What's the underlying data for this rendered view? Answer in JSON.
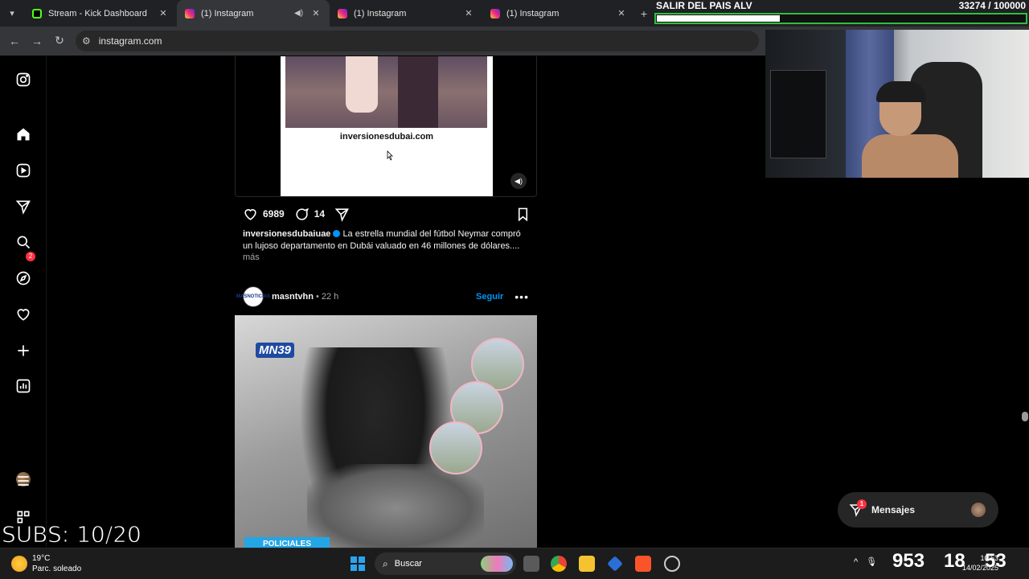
{
  "browser": {
    "tabs": [
      {
        "title": "Stream - Kick Dashboard",
        "favicon": "kick-icon",
        "active": false
      },
      {
        "title": "(1) Instagram",
        "favicon": "instagram-icon",
        "active": true,
        "audio": true
      },
      {
        "title": "(1) Instagram",
        "favicon": "instagram-icon",
        "active": false
      },
      {
        "title": "(1) Instagram",
        "favicon": "instagram-icon",
        "active": false
      }
    ],
    "url": "instagram.com"
  },
  "sidebar": {
    "notifications_badge": "2",
    "icons": [
      "instagram-logo-icon",
      "home-icon",
      "reels-icon",
      "messages-icon",
      "search-icon",
      "explore-icon",
      "heart-icon",
      "create-icon",
      "dashboard-icon",
      "profile-avatar",
      "menu-icon",
      "meta-icon"
    ]
  },
  "post1": {
    "video_text": "inversionesdubai.com",
    "likes": "6989",
    "comments": "14",
    "username": "inversionesdubaiuae",
    "caption": "La estrella mundial del fútbol Neymar compró un lujoso departamento en Dubái valuado en 46 millones de dólares....",
    "more": "más"
  },
  "post2": {
    "avatar_text": "MASNOTICIAS",
    "username": "masntvhn",
    "separator": "•",
    "time": "22 h",
    "follow": "Seguir",
    "brand": "MN39",
    "tag": "POLICIALES"
  },
  "messages": {
    "label": "Mensajes",
    "badge": "1"
  },
  "overlay": {
    "goal_title": "SALIR DEL PAIS ALV",
    "goal_count": "33274 / 100000",
    "goal_progress": 0.333,
    "subs": "SUBS: 10/20"
  },
  "taskbar": {
    "temperature": "19°C",
    "weather": "Parc. soleado",
    "search": "Buscar",
    "timer_hours": "953",
    "timer_minutes": "18",
    "timer_seconds": "53",
    "time": "10:53",
    "date": "14/02/2025"
  }
}
